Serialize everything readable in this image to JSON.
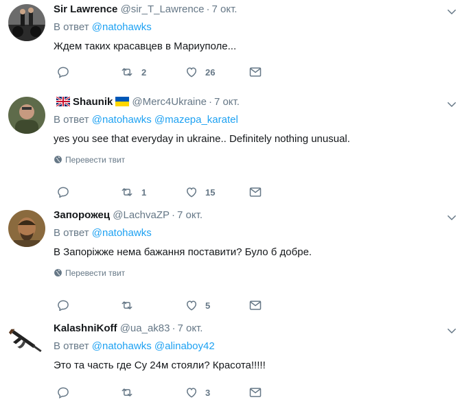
{
  "reply_prefix": "В ответ",
  "translate_label": "Перевести твит",
  "colors": {
    "accent": "#1da1f2",
    "secondary": "#657786",
    "text": "#14171a",
    "divider": "#e6ecf0"
  },
  "tweets": [
    {
      "name": "Sir Lawrence",
      "handle": "@sir_T_Lawrence",
      "time": "7 окт.",
      "mentions": [
        "@natohawks"
      ],
      "text": "Ждем таких красавцев в Мариуполе...",
      "retweets": "2",
      "likes": "26",
      "avatar_icon": "bikers-avatar"
    },
    {
      "name": "Shaunik",
      "handle": "@Merc4Ukraine",
      "time": "7 окт.",
      "name_prefix_icon": "uk-flag-icon",
      "name_suffix_icon": "ukraine-flag-icon",
      "mentions": [
        "@natohawks",
        "@mazepa_karatel"
      ],
      "text": "yes you see that everyday in ukraine.. Definitely nothing unusual.",
      "retweets": "1",
      "likes": "15",
      "avatar_icon": "man-portrait-avatar"
    },
    {
      "name": "Запорожец",
      "handle": "@LachvaZP",
      "time": "7 окт.",
      "mentions": [
        "@natohawks"
      ],
      "text": "В Запоріжже нема бажання поставити? Було б добре.",
      "retweets": "",
      "likes": "5",
      "avatar_icon": "cossack-portrait-avatar"
    },
    {
      "name": "KalashniKoff",
      "handle": "@ua_ak83",
      "time": "7 окт.",
      "mentions": [
        "@natohawks",
        "@alinaboy42"
      ],
      "text": "Это та часть где Су 24м стояли? Красота!!!!!",
      "retweets": "",
      "likes": "3",
      "avatar_icon": "rifle-avatar"
    }
  ]
}
